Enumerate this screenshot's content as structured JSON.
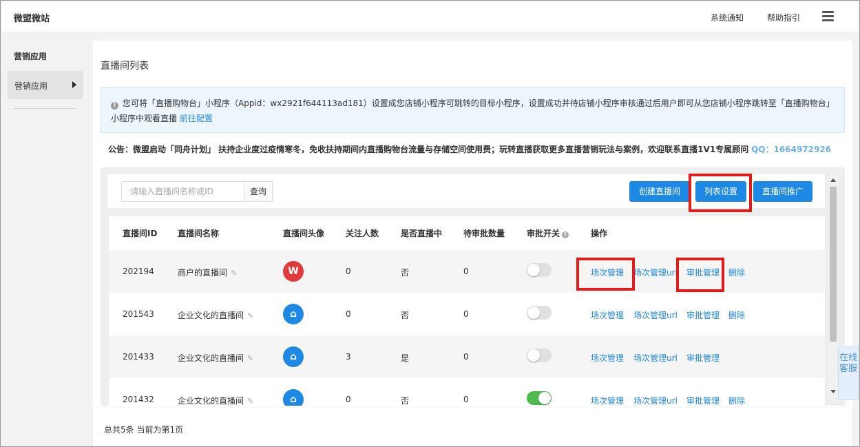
{
  "topbar": {
    "brand": "微盟微站",
    "notice_link": "系统通知",
    "help_link": "帮助指引",
    "menu_icon": "hamburger-icon"
  },
  "sidebar": {
    "title": "营销应用",
    "items": [
      {
        "label": "营销应用",
        "icon": "arrow-right-icon"
      }
    ]
  },
  "page": {
    "title": "直播间列表",
    "info": {
      "icon": "info-icon",
      "text": "您可将「直播购物台」小程序（Appid：wx2921f644113ad181）设置成您店铺小程序可跳转的目标小程序，设置成功并待店铺小程序审核通过后用户即可从您店铺小程序跳转至「直播购物台」小程序中观看直播",
      "link": "前往配置"
    },
    "notice": {
      "text": "公告：微盟启动「同舟计划」 扶持企业度过疫情寒冬，免收扶持期间内直播购物台流量与存储空间使用费；玩转直播获取更多直播营销玩法与案例，欢迎联系直播1V1专属顾问",
      "qq": "QQ：1664972926"
    }
  },
  "toolbar": {
    "search_placeholder": "请输入直播间名称或ID",
    "search_button": "查询",
    "create_button": "创建直播间",
    "settings_button": "列表设置",
    "promote_button": "直播间推广"
  },
  "table": {
    "headers": {
      "id": "直播间ID",
      "name": "直播间名称",
      "avatar": "直播间头像",
      "followers": "关注人数",
      "live": "是否直播中",
      "pending": "待审批数量",
      "approval": "审批开关",
      "actions": "操作"
    },
    "rows": [
      {
        "id": "202194",
        "name": "商户的直播间",
        "avatar": "W",
        "avatar_color": "#e03a3a",
        "followers": "0",
        "live": "否",
        "pending": "0",
        "approval_on": false,
        "actions": {
          "session": "场次管理",
          "session_url": "场次管理url",
          "approve": "审批管理",
          "delete": "删除"
        }
      },
      {
        "id": "201543",
        "name": "企业文化的直播间",
        "avatar": "⌂",
        "avatar_color": "#1e88e5",
        "followers": "0",
        "live": "否",
        "pending": "0",
        "approval_on": false,
        "actions": {
          "session": "场次管理",
          "session_url": "场次管理url",
          "approve": "审批管理",
          "delete": "删除"
        }
      },
      {
        "id": "201433",
        "name": "企业文化的直播间",
        "avatar": "⌂",
        "avatar_color": "#1e88e5",
        "followers": "3",
        "live": "是",
        "pending": "0",
        "approval_on": false,
        "actions": {
          "session": "场次管理",
          "session_url": "场次管理url",
          "approve": "审批管理"
        }
      },
      {
        "id": "201432",
        "name": "企业文化的直播间",
        "avatar": "⌂",
        "avatar_color": "#1e88e5",
        "followers": "0",
        "live": "否",
        "pending": "0",
        "approval_on": true,
        "actions": {
          "session": "场次管理",
          "session_url": "场次管理url",
          "approve": "审批管理",
          "delete": "删除"
        }
      }
    ]
  },
  "footer": {
    "summary": "总共5条 当前为第1页"
  },
  "service": {
    "label": "在线客服"
  },
  "colors": {
    "primary": "#1e88e5",
    "highlight": "#e31b1b",
    "toggle_on": "#4cbb4c"
  }
}
